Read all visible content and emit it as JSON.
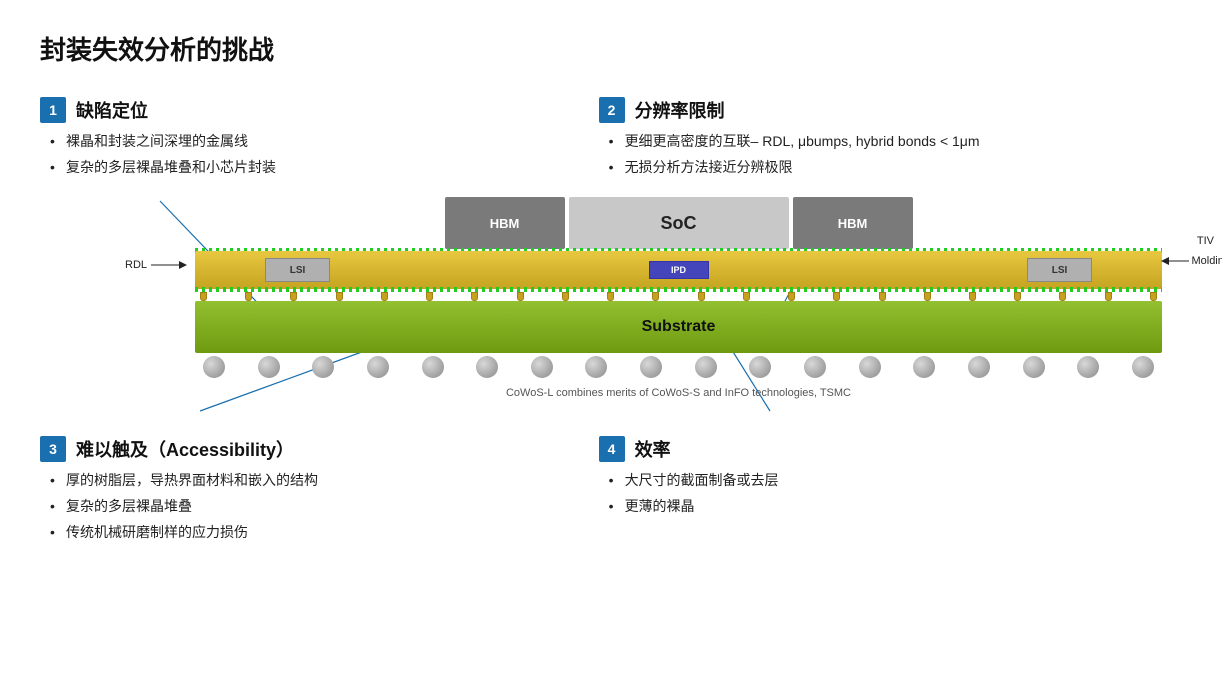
{
  "title": "封装失效分析的挑战",
  "sections": {
    "s1": {
      "number": "1",
      "title": "缺陷定位",
      "bullets": [
        "裸晶和封装之间深埋的金属线",
        "复杂的多层裸晶堆叠和小芯片封装"
      ]
    },
    "s2": {
      "number": "2",
      "title": "分辨率限制",
      "bullets": [
        "更细更高密度的互联– RDL, μbumps, hybrid bonds < 1μm",
        "无损分析方法接近分辨极限"
      ]
    },
    "s3": {
      "number": "3",
      "title": "难以触及（Accessibility）",
      "bullets": [
        "厚的树脂层，导热界面材料和嵌入的结构",
        "复杂的多层裸晶堆叠",
        "传统机械研磨制样的应力损伤"
      ]
    },
    "s4": {
      "number": "4",
      "title": "效率",
      "bullets": [
        "大尺寸的截面制备或去层",
        "更薄的裸晶"
      ]
    }
  },
  "diagram": {
    "hbm_label": "HBM",
    "soc_label": "SoC",
    "lsi_label": "LSI",
    "ipd_label": "IPD",
    "substrate_label": "Substrate",
    "rdl_label": "RDL",
    "tiv_label": "TIV",
    "molding_label": "Molding",
    "caption": "CoWoS-L combines merits of CoWoS-S and InFO technologies, TSMC"
  }
}
